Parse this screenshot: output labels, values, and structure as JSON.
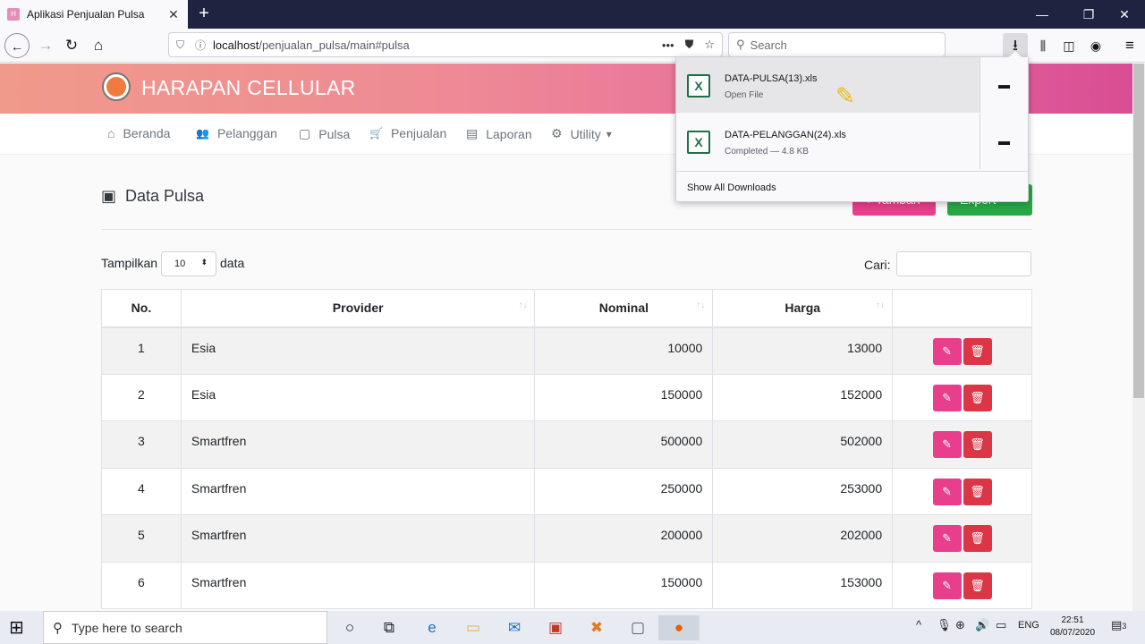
{
  "browser": {
    "tab_title": "Aplikasi Penjualan Pulsa",
    "tab_close": "✕",
    "new_tab": "+",
    "url_host": "localhost",
    "url_path": "/penjualan_pulsa/main#pulsa",
    "url_more": "•••",
    "search_placeholder": "Search"
  },
  "site": {
    "brand": "HARAPAN CELLULAR",
    "menu": [
      {
        "label": "Beranda",
        "icon": "home-icon",
        "glyph": "⌂"
      },
      {
        "label": "Pelanggan",
        "icon": "users-icon",
        "glyph": "👥"
      },
      {
        "label": "Pulsa",
        "icon": "tablet-icon",
        "glyph": "▢"
      },
      {
        "label": "Penjualan",
        "icon": "cart-icon",
        "glyph": "🛒"
      },
      {
        "label": "Laporan",
        "icon": "file-icon",
        "glyph": "▤"
      },
      {
        "label": "Utility",
        "icon": "user-cog-icon",
        "glyph": "⚙"
      }
    ],
    "utility_caret": "▾"
  },
  "page": {
    "title": "Data Pulsa",
    "btn_tambah": "+ Tambah",
    "btn_export": "Export",
    "show_label": "Tampilkan",
    "show_value": "10",
    "show_suffix": "data",
    "search_label": "Cari:"
  },
  "table": {
    "headers": [
      "No.",
      "Provider",
      "Nominal",
      "Harga",
      ""
    ],
    "rows": [
      {
        "no": "1",
        "provider": "Esia",
        "nominal": "10000",
        "harga": "13000"
      },
      {
        "no": "2",
        "provider": "Esia",
        "nominal": "150000",
        "harga": "152000"
      },
      {
        "no": "3",
        "provider": "Smartfren",
        "nominal": "500000",
        "harga": "502000"
      },
      {
        "no": "4",
        "provider": "Smartfren",
        "nominal": "250000",
        "harga": "253000"
      },
      {
        "no": "5",
        "provider": "Smartfren",
        "nominal": "200000",
        "harga": "202000"
      },
      {
        "no": "6",
        "provider": "Smartfren",
        "nominal": "150000",
        "harga": "153000"
      }
    ]
  },
  "downloads": {
    "items": [
      {
        "name": "DATA-PULSA(13).xls",
        "status": "Open File"
      },
      {
        "name": "DATA-PELANGGAN(24).xls",
        "status": "Completed — 4.8 KB"
      }
    ],
    "show_all": "Show All Downloads"
  },
  "taskbar": {
    "search_placeholder": "Type here to search",
    "lang": "ENG",
    "time": "22:51",
    "date": "08/07/2020",
    "notif_count": "3"
  },
  "colors": {
    "tambah": "#e83e8c",
    "export": "#28a745",
    "edit": "#e83e8c",
    "delete": "#dc3545"
  }
}
